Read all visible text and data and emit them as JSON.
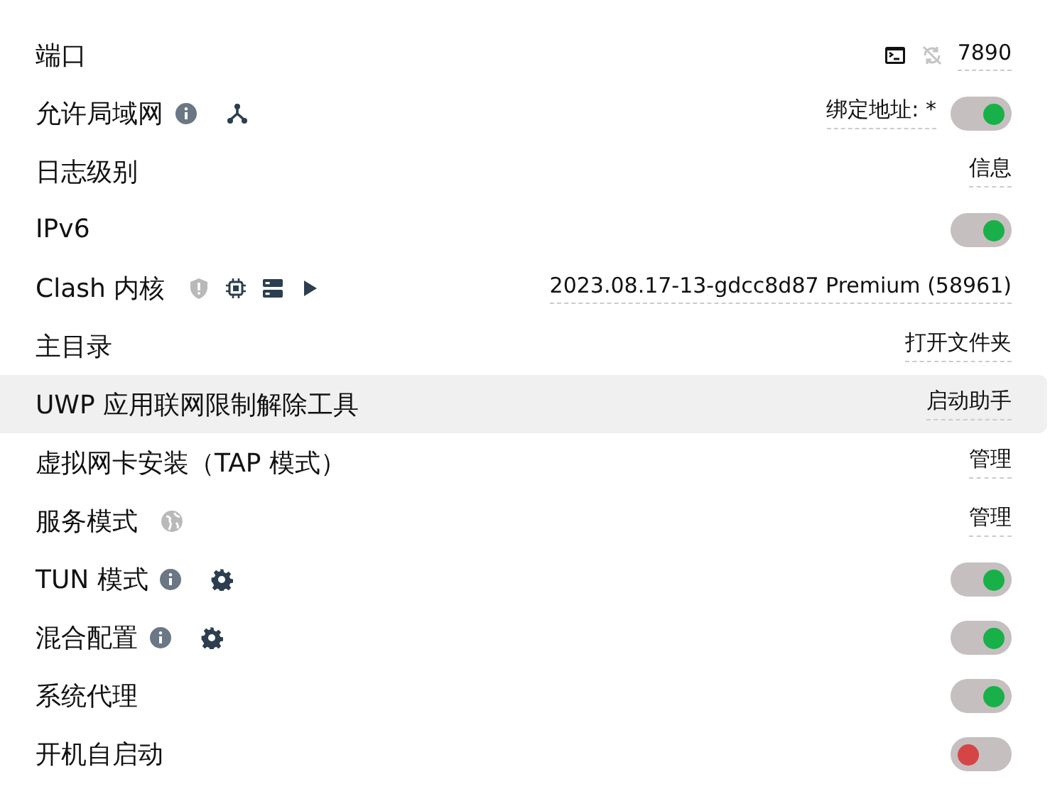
{
  "rows": [
    {
      "label": "端口",
      "highlighted": false,
      "icons": [],
      "actions": [
        {
          "kind": "terminal",
          "disabled": false
        },
        {
          "kind": "sync",
          "disabled": true
        },
        {
          "kind": "link",
          "text": "7890"
        }
      ]
    },
    {
      "label": "允许局域网",
      "highlighted": false,
      "icons": [
        {
          "kind": "info",
          "disabled": false
        },
        {
          "kind": "network",
          "disabled": false
        }
      ],
      "actions": [
        {
          "kind": "link",
          "text": "绑定地址: *"
        },
        {
          "kind": "toggle",
          "on": true
        }
      ]
    },
    {
      "label": "日志级别",
      "highlighted": false,
      "icons": [],
      "actions": [
        {
          "kind": "link",
          "text": "信息"
        }
      ]
    },
    {
      "label": "IPv6",
      "highlighted": false,
      "icons": [],
      "actions": [
        {
          "kind": "toggle",
          "on": true
        }
      ]
    },
    {
      "label": "Clash 内核",
      "highlighted": false,
      "icons": [
        {
          "kind": "shield",
          "disabled": true
        },
        {
          "kind": "chip",
          "disabled": false
        },
        {
          "kind": "server",
          "disabled": false
        },
        {
          "kind": "play",
          "disabled": false
        }
      ],
      "actions": [
        {
          "kind": "link",
          "text": "2023.08.17-13-gdcc8d87 Premium (58961)"
        }
      ]
    },
    {
      "label": "主目录",
      "highlighted": false,
      "icons": [],
      "actions": [
        {
          "kind": "link",
          "text": "打开文件夹"
        }
      ]
    },
    {
      "label": "UWP 应用联网限制解除工具",
      "highlighted": true,
      "icons": [],
      "actions": [
        {
          "kind": "link",
          "text": "启动助手"
        }
      ]
    },
    {
      "label": "虚拟网卡安装（TAP 模式）",
      "highlighted": false,
      "icons": [],
      "actions": [
        {
          "kind": "link",
          "text": "管理"
        }
      ]
    },
    {
      "label": "服务模式",
      "highlighted": false,
      "icons": [
        {
          "kind": "globe",
          "disabled": true
        }
      ],
      "actions": [
        {
          "kind": "link",
          "text": "管理"
        }
      ]
    },
    {
      "label": "TUN 模式",
      "highlighted": false,
      "icons": [
        {
          "kind": "info",
          "disabled": false
        },
        {
          "kind": "gear",
          "disabled": false
        }
      ],
      "actions": [
        {
          "kind": "toggle",
          "on": true
        }
      ]
    },
    {
      "label": "混合配置",
      "highlighted": false,
      "icons": [
        {
          "kind": "info",
          "disabled": false
        },
        {
          "kind": "gear",
          "disabled": false
        }
      ],
      "actions": [
        {
          "kind": "toggle",
          "on": true
        }
      ]
    },
    {
      "label": "系统代理",
      "highlighted": false,
      "icons": [],
      "actions": [
        {
          "kind": "toggle",
          "on": true
        }
      ]
    },
    {
      "label": "开机自启动",
      "highlighted": false,
      "icons": [],
      "actions": [
        {
          "kind": "toggle",
          "on": false
        }
      ]
    }
  ]
}
